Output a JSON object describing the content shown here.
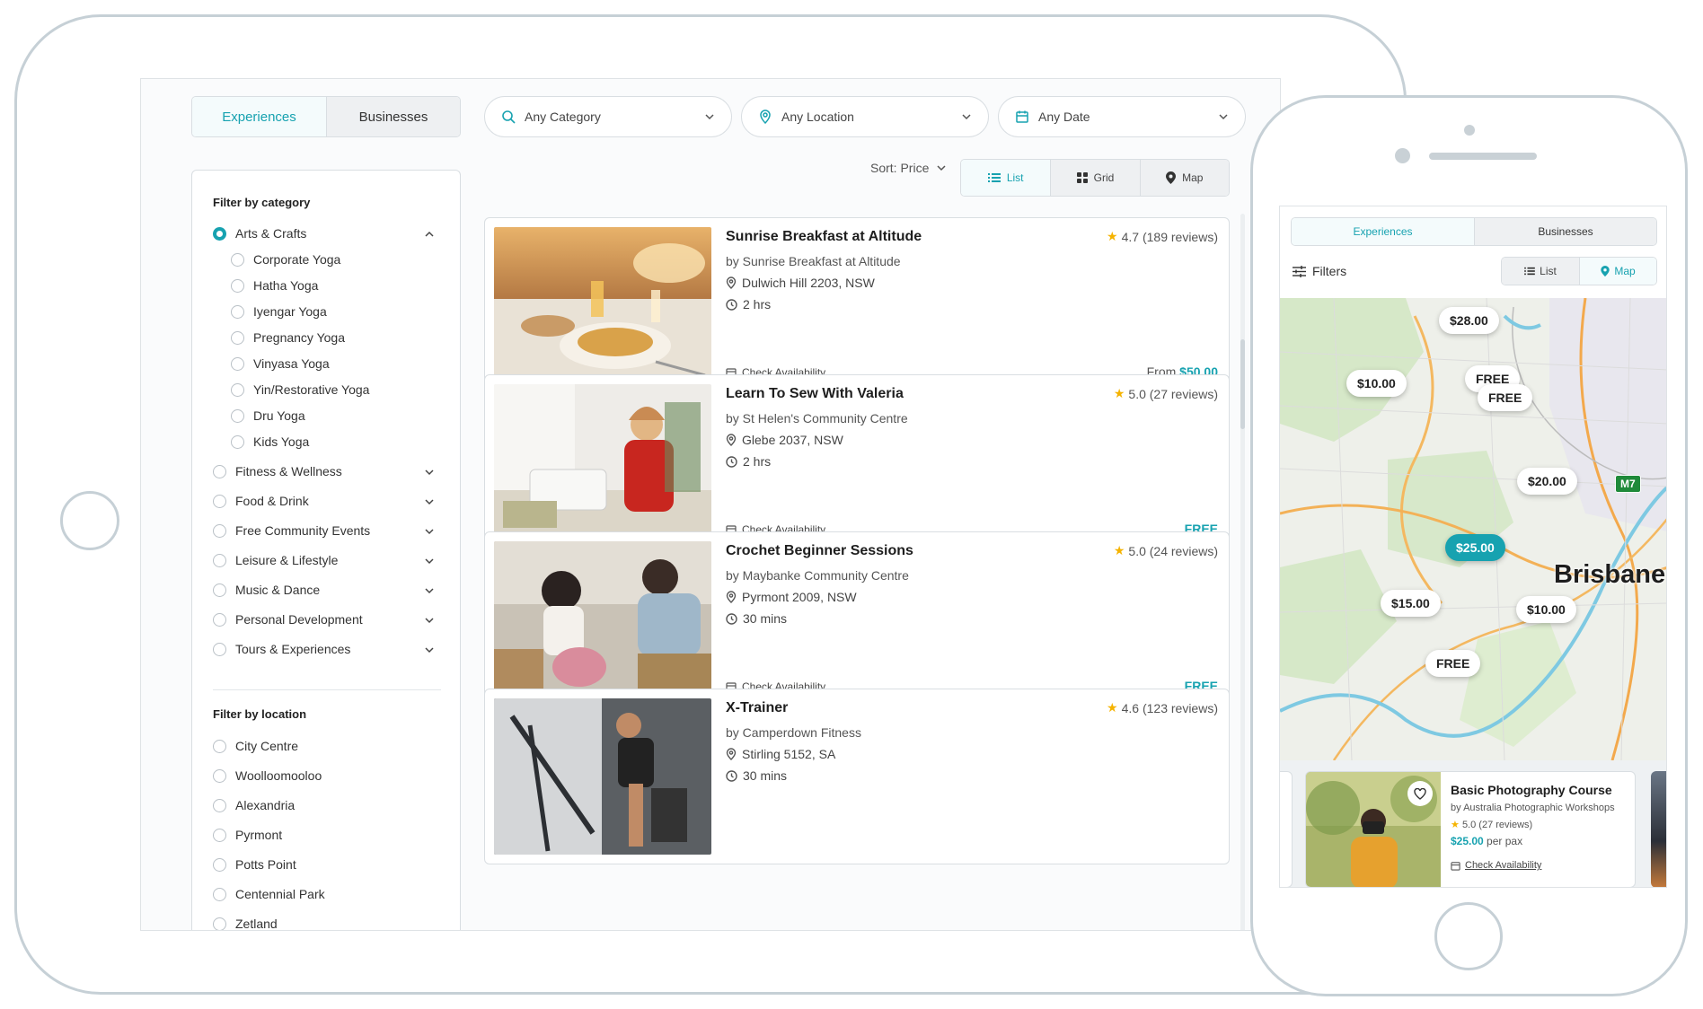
{
  "tablet": {
    "tabs": [
      {
        "label": "Experiences",
        "active": true
      },
      {
        "label": "Businesses",
        "active": false
      }
    ],
    "filters": {
      "category": {
        "label": "Any Category",
        "icon": "search-icon"
      },
      "location": {
        "label": "Any Location",
        "icon": "location-pin-icon"
      },
      "date": {
        "label": "Any Date",
        "icon": "calendar-icon"
      }
    },
    "sort_label": "Sort: Price",
    "views": [
      {
        "label": "List",
        "icon": "list-icon",
        "active": true
      },
      {
        "label": "Grid",
        "icon": "grid-icon",
        "active": false
      },
      {
        "label": "Map",
        "icon": "map-pin-icon",
        "active": false
      }
    ],
    "sidebar": {
      "category_title": "Filter by category",
      "categories": [
        {
          "label": "Arts & Crafts",
          "selected": true,
          "expanded": true
        },
        {
          "label": "Fitness & Wellness"
        },
        {
          "label": "Food & Drink"
        },
        {
          "label": "Free Community Events"
        },
        {
          "label": "Leisure & Lifestyle"
        },
        {
          "label": "Music & Dance"
        },
        {
          "label": "Personal Development"
        },
        {
          "label": "Tours & Experiences"
        }
      ],
      "subcategories": [
        "Corporate Yoga",
        "Hatha Yoga",
        "Iyengar Yoga",
        "Pregnancy Yoga",
        "Vinyasa Yoga",
        "Yin/Restorative Yoga",
        "Dru Yoga",
        "Kids Yoga"
      ],
      "location_title": "Filter by location",
      "locations": [
        "City Centre",
        "Woolloomooloo",
        "Alexandria",
        "Pyrmont",
        "Potts Point",
        "Centennial Park",
        "Zetland"
      ]
    },
    "listings": [
      {
        "title": "Sunrise Breakfast at Altitude",
        "rating": "4.7 (189 reviews)",
        "by": "by Sunrise Breakfast at Altitude",
        "location": "Dulwich Hill 2203, NSW",
        "duration": "2 hrs",
        "check": "Check Availability",
        "price_prefix": "From",
        "price": "$50.00"
      },
      {
        "title": "Learn To Sew With Valeria",
        "rating": "5.0 (27 reviews)",
        "by": "by St Helen's Community Centre",
        "location": "Glebe 2037, NSW",
        "duration": "2 hrs",
        "check": "Check Availability",
        "price_prefix": "",
        "price": "FREE"
      },
      {
        "title": "Crochet Beginner Sessions",
        "rating": "5.0 (24 reviews)",
        "by": "by Maybanke Community Centre",
        "location": "Pyrmont 2009, NSW",
        "duration": "30 mins",
        "check": "Check Availability",
        "price_prefix": "",
        "price": "FREE"
      },
      {
        "title": "X-Trainer",
        "rating": "4.6 (123 reviews)",
        "by": "by Camperdown Fitness",
        "location": "Stirling 5152, SA",
        "duration": "30 mins",
        "check": "",
        "price_prefix": "",
        "price": ""
      }
    ]
  },
  "phone": {
    "tabs": [
      {
        "label": "Experiences",
        "active": true
      },
      {
        "label": "Businesses",
        "active": false
      }
    ],
    "filters_label": "Filters",
    "views": [
      {
        "label": "List",
        "icon": "list-icon",
        "active": false
      },
      {
        "label": "Map",
        "icon": "map-pin-icon",
        "active": true
      }
    ],
    "map": {
      "city": "Brisbane",
      "road": "M7",
      "pins": [
        "$28.00",
        "$10.00",
        "FREE",
        "FREE",
        "$20.00",
        "$25.00",
        "$15.00",
        "$10.00",
        "FREE"
      ]
    },
    "card": {
      "title": "Basic Photography Course",
      "by": "by Australia Photographic Workshops",
      "rating": "5.0 (27 reviews)",
      "price": "$25.00",
      "price_suffix": "per pax",
      "check": "Check Availability"
    }
  },
  "colors": {
    "accent": "#17a2b0",
    "star": "#f5b301",
    "border": "#d9dee2"
  }
}
